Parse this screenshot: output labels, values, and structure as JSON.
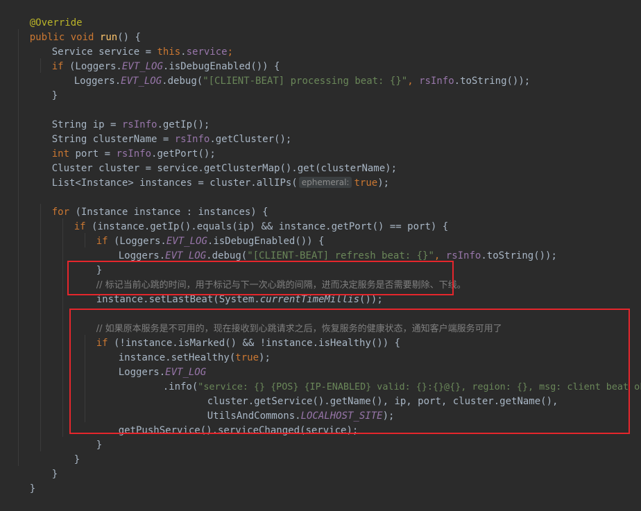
{
  "code": {
    "annotation": "@Override",
    "l_signature": [
      "public",
      "void",
      "run",
      "() {"
    ],
    "l_service": [
      "Service service = ",
      "this",
      ".",
      "service",
      ";"
    ],
    "l_if1": [
      "if",
      " (Loggers.",
      "EVT_LOG",
      ".isDebugEnabled()) {"
    ],
    "l_debug1": [
      "Loggers.",
      "EVT_LOG",
      ".debug(",
      "\"[CLIENT-BEAT] processing beat: {}\"",
      ", ",
      "rsInfo",
      ".toString());"
    ],
    "l_close": "}",
    "l_ip": [
      "String ip = ",
      "rsInfo",
      ".getIp();"
    ],
    "l_cluster_name": [
      "String clusterName = ",
      "rsInfo",
      ".getCluster();"
    ],
    "l_port": [
      "int",
      " port = ",
      "rsInfo",
      ".getPort();"
    ],
    "l_cluster": [
      "Cluster cluster = service.getClusterMap().get(clusterName);"
    ],
    "l_instances": [
      "List<Instance> instances = cluster.allIPs(",
      "ephemeral:",
      "true",
      ");"
    ],
    "l_for": [
      "for",
      " (Instance instance : instances) {"
    ],
    "l_if2": [
      "if",
      " (instance.getIp().equals(ip) && instance.getPort() == port) {"
    ],
    "l_if3": [
      "if",
      " (Loggers.",
      "EVT_LOG",
      ".isDebugEnabled()) {"
    ],
    "l_debug2": [
      "Loggers.",
      "EVT_LOG",
      ".debug(",
      "\"[CLIENT-BEAT] refresh beat: {}\"",
      ", ",
      "rsInfo",
      ".toString());"
    ],
    "l_comment1": "// 标记当前心跳的时间，用于标记与下一次心跳的间隔，进而决定服务是否需要剔除、下线。",
    "l_setbeat": [
      "instance.setLastBeat(System.",
      "currentTimeMillis",
      "());"
    ],
    "l_comment2": "// 如果原本服务是不可用的，现在接收到心跳请求之后，恢复服务的健康状态，通知客户端服务可用了",
    "l_if4": [
      "if",
      " (!instance.isMarked() && !instance.isHealthy()) {"
    ],
    "l_sethealthy": [
      "instance.setHealthy(",
      "true",
      ");"
    ],
    "l_loggers": [
      "Loggers.",
      "EVT_LOG"
    ],
    "l_info": [
      ".info(",
      "\"service: {} {POS} {IP-ENABLED} valid: {}:{}@{}, region: {}, msg: client beat ok\"",
      ","
    ],
    "l_args1": [
      "cluster.getService().getName(), ip, port, cluster.getName(),"
    ],
    "l_args2": [
      "UtilsAndCommons.",
      "LOCALHOST_SITE",
      ");"
    ],
    "l_push": [
      "getPushService().serviceChanged(service);"
    ]
  },
  "colors": {
    "background": "#2b2b2b",
    "keyword": "#cc7832",
    "string": "#6a8759",
    "field": "#9876aa",
    "method": "#ffc66d",
    "comment": "#808080",
    "highlight_box": "#e5262c"
  }
}
